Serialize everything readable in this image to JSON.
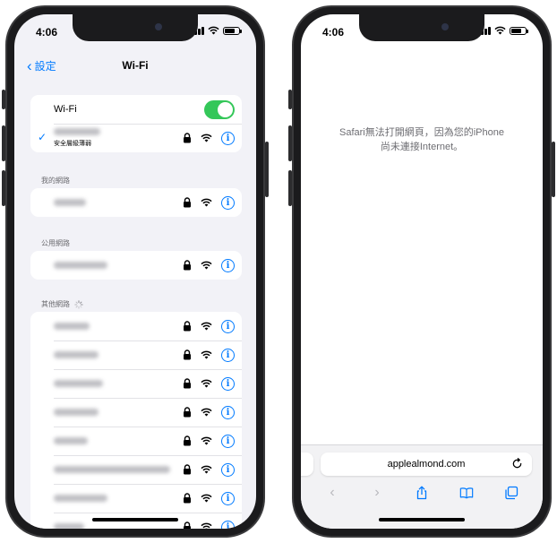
{
  "status": {
    "time": "4:06"
  },
  "settings": {
    "back_label": "設定",
    "title": "Wi-Fi",
    "wifi_toggle_label": "Wi-Fi",
    "connected_network_security": "安全層級薄弱",
    "section_my_networks": "我的網路",
    "section_public_networks": "公用網路",
    "section_other_networks": "其他網路",
    "other_network_count_visible": 8
  },
  "safari": {
    "error_line1": "Safari無法打開網頁，因為您的iPhone",
    "error_line2": "尚未連接Internet。",
    "url": "applealmond.com"
  },
  "colors": {
    "accent": "#007aff",
    "toggle_on": "#34c759",
    "grouped_background": "#f2f2f7",
    "section_text": "#6d6d72"
  },
  "icons": {
    "back": "chevron-left-icon",
    "check": "checkmark-icon",
    "lock": "lock-icon",
    "wifi": "wifi-icon",
    "info": "info-icon",
    "reload": "reload-icon",
    "share": "share-icon",
    "bookmarks": "book-icon",
    "tabs": "tabs-icon"
  }
}
